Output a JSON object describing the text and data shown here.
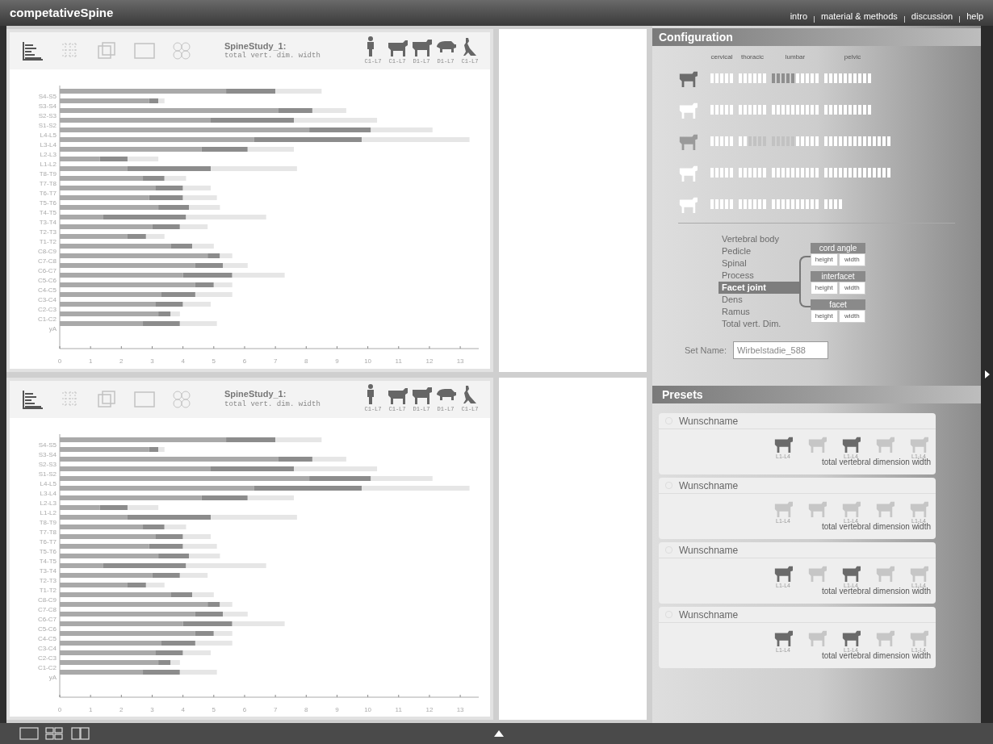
{
  "app_title": "competativeSpine",
  "nav": [
    "intro",
    "material & methods",
    "discussion",
    "help"
  ],
  "panels": [
    {
      "view_tools": [
        {
          "kind": "bars",
          "selected": true
        },
        {
          "kind": "grid",
          "selected": false
        },
        {
          "kind": "cube",
          "selected": false
        },
        {
          "kind": "frame",
          "selected": false
        },
        {
          "kind": "cluster",
          "selected": false
        }
      ],
      "title": "SpineStudy_1:",
      "subtitle": "total vert. dim. width",
      "species": [
        {
          "kind": "human",
          "label": "C1-L7"
        },
        {
          "kind": "sheep",
          "label": "C1-L7"
        },
        {
          "kind": "cow",
          "label": "D1-L7"
        },
        {
          "kind": "pig",
          "label": "D1-L7"
        },
        {
          "kind": "kangaroo",
          "label": "C1-L7"
        }
      ],
      "chart_data": {
        "type": "bar",
        "orientation": "horizontal",
        "stacked": true,
        "categories": [
          "S4-S5",
          "S3-S4",
          "S2-S3",
          "S1-S2",
          "L4-L5",
          "L3-L4",
          "L2-L3",
          "L1-L2",
          "T8-T9",
          "T7-T8",
          "T6-T7",
          "T5-T6",
          "T4-T5",
          "T3-T4",
          "T2-T3",
          "T1-T2",
          "C8-C9",
          "C7-C8",
          "C6-C7",
          "C5-C6",
          "C4-C5",
          "C3-C4",
          "C2-C3",
          "C1-C2",
          "yA"
        ],
        "series": [
          {
            "color": "#a9a9a9",
            "values": [
              5.4,
              2.9,
              7.1,
              4.9,
              8.1,
              6.3,
              4.6,
              1.3,
              2.2,
              2.7,
              3.1,
              2.9,
              3.2,
              1.4,
              3.0,
              2.2,
              3.6,
              4.8,
              4.4,
              4.0,
              4.4,
              3.3,
              3.1,
              3.2,
              2.7
            ]
          },
          {
            "color": "#8c8c8c",
            "values": [
              1.6,
              0.3,
              1.1,
              2.7,
              2.0,
              3.5,
              1.5,
              0.9,
              2.7,
              0.7,
              0.9,
              1.1,
              1.0,
              2.7,
              0.9,
              0.6,
              0.7,
              0.4,
              0.9,
              1.6,
              0.6,
              1.1,
              0.9,
              0.4,
              1.2
            ]
          },
          {
            "color": "#e6e6e6",
            "values": [
              1.5,
              0.2,
              1.1,
              2.7,
              2.0,
              3.5,
              1.5,
              1.0,
              2.8,
              0.7,
              0.9,
              1.1,
              1.0,
              2.6,
              0.9,
              0.6,
              0.7,
              0.4,
              0.8,
              1.7,
              0.6,
              1.2,
              0.9,
              0.3,
              1.2
            ]
          }
        ],
        "xlim": [
          0,
          13.6
        ],
        "xticks": [
          0,
          1,
          2,
          3,
          4,
          5,
          6,
          7,
          8,
          9,
          10,
          11,
          12,
          13
        ]
      }
    },
    {
      "view_tools": [
        {
          "kind": "bars",
          "selected": true
        },
        {
          "kind": "grid",
          "selected": false
        },
        {
          "kind": "cube",
          "selected": false
        },
        {
          "kind": "frame",
          "selected": false
        },
        {
          "kind": "cluster",
          "selected": false
        }
      ],
      "title": "SpineStudy_1:",
      "subtitle": "total vert. dim. width",
      "species": [
        {
          "kind": "human",
          "label": "C1-L7"
        },
        {
          "kind": "sheep",
          "label": "C1-L7"
        },
        {
          "kind": "cow",
          "label": "D1-L7"
        },
        {
          "kind": "pig",
          "label": "D1-L7"
        },
        {
          "kind": "kangaroo",
          "label": "C1-L7"
        }
      ],
      "chart_data": {
        "type": "bar",
        "orientation": "horizontal",
        "stacked": true,
        "categories": [
          "S4-S5",
          "S3-S4",
          "S2-S3",
          "S1-S2",
          "L4-L5",
          "L3-L4",
          "L2-L3",
          "L1-L2",
          "T8-T9",
          "T7-T8",
          "T6-T7",
          "T5-T6",
          "T4-T5",
          "T3-T4",
          "T2-T3",
          "T1-T2",
          "C8-C9",
          "C7-C8",
          "C6-C7",
          "C5-C6",
          "C4-C5",
          "C3-C4",
          "C2-C3",
          "C1-C2",
          "yA"
        ],
        "series": [
          {
            "color": "#a9a9a9",
            "values": [
              5.4,
              2.9,
              7.1,
              4.9,
              8.1,
              6.3,
              4.6,
              1.3,
              2.2,
              2.7,
              3.1,
              2.9,
              3.2,
              1.4,
              3.0,
              2.2,
              3.6,
              4.8,
              4.4,
              4.0,
              4.4,
              3.3,
              3.1,
              3.2,
              2.7
            ]
          },
          {
            "color": "#8c8c8c",
            "values": [
              1.6,
              0.3,
              1.1,
              2.7,
              2.0,
              3.5,
              1.5,
              0.9,
              2.7,
              0.7,
              0.9,
              1.1,
              1.0,
              2.7,
              0.9,
              0.6,
              0.7,
              0.4,
              0.9,
              1.6,
              0.6,
              1.1,
              0.9,
              0.4,
              1.2
            ]
          },
          {
            "color": "#e6e6e6",
            "values": [
              1.5,
              0.2,
              1.1,
              2.7,
              2.0,
              3.5,
              1.5,
              1.0,
              2.8,
              0.7,
              0.9,
              1.1,
              1.0,
              2.6,
              0.9,
              0.6,
              0.7,
              0.4,
              0.8,
              1.7,
              0.6,
              1.2,
              0.9,
              0.3,
              1.2
            ]
          }
        ],
        "xlim": [
          0,
          13.6
        ],
        "xticks": [
          0,
          1,
          2,
          3,
          4,
          5,
          6,
          7,
          8,
          9,
          10,
          11,
          12,
          13
        ]
      }
    }
  ],
  "configuration": {
    "title": "Configuration",
    "regions": [
      "cervical",
      "thoracic",
      "lumbar",
      "pelvic"
    ],
    "rows": [
      {
        "color": "#6b6b6b",
        "groups": [
          [
            {
              "kind": "plain"
            },
            {
              "kind": "plain"
            },
            {
              "kind": "plain"
            },
            {
              "kind": "plain"
            },
            {
              "kind": "plain"
            }
          ],
          [
            {
              "kind": "plain"
            },
            {
              "kind": "plain"
            },
            {
              "kind": "plain"
            },
            {
              "kind": "plain"
            },
            {
              "kind": "plain"
            },
            {
              "kind": "plain"
            }
          ],
          [
            {
              "kind": "dark"
            },
            {
              "kind": "dark"
            },
            {
              "kind": "dark"
            },
            {
              "kind": "dark"
            },
            {
              "kind": "dark"
            },
            {
              "kind": "plain"
            },
            {
              "kind": "plain"
            },
            {
              "kind": "plain"
            },
            {
              "kind": "plain"
            },
            {
              "kind": "plain"
            }
          ],
          [
            {
              "kind": "plain"
            },
            {
              "kind": "plain"
            },
            {
              "kind": "plain"
            },
            {
              "kind": "plain"
            },
            {
              "kind": "plain"
            },
            {
              "kind": "plain"
            },
            {
              "kind": "plain"
            },
            {
              "kind": "plain"
            },
            {
              "kind": "plain"
            },
            {
              "kind": "plain"
            }
          ]
        ]
      },
      {
        "color": "#ffffff",
        "groups": [
          [
            {
              "kind": "plain"
            },
            {
              "kind": "plain"
            },
            {
              "kind": "plain"
            },
            {
              "kind": "plain"
            },
            {
              "kind": "plain"
            }
          ],
          [
            {
              "kind": "plain"
            },
            {
              "kind": "plain"
            },
            {
              "kind": "plain"
            },
            {
              "kind": "plain"
            },
            {
              "kind": "plain"
            },
            {
              "kind": "plain"
            }
          ],
          [
            {
              "kind": "plain"
            },
            {
              "kind": "plain"
            },
            {
              "kind": "plain"
            },
            {
              "kind": "plain"
            },
            {
              "kind": "plain"
            },
            {
              "kind": "plain"
            },
            {
              "kind": "plain"
            },
            {
              "kind": "plain"
            },
            {
              "kind": "plain"
            },
            {
              "kind": "plain"
            }
          ],
          [
            {
              "kind": "plain"
            },
            {
              "kind": "plain"
            },
            {
              "kind": "plain"
            },
            {
              "kind": "plain"
            },
            {
              "kind": "plain"
            },
            {
              "kind": "plain"
            },
            {
              "kind": "plain"
            },
            {
              "kind": "plain"
            },
            {
              "kind": "plain"
            },
            {
              "kind": "plain"
            }
          ]
        ]
      },
      {
        "color": "#9a9a9a",
        "groups": [
          [
            {
              "kind": "plain"
            },
            {
              "kind": "plain"
            },
            {
              "kind": "plain"
            },
            {
              "kind": "plain"
            },
            {
              "kind": "plain"
            }
          ],
          [
            {
              "kind": "plain"
            },
            {
              "kind": "plain"
            },
            {
              "kind": "faint"
            },
            {
              "kind": "faint"
            },
            {
              "kind": "faint"
            },
            {
              "kind": "faint"
            }
          ],
          [
            {
              "kind": "faint"
            },
            {
              "kind": "faint"
            },
            {
              "kind": "faint"
            },
            {
              "kind": "faint"
            },
            {
              "kind": "faint"
            },
            {
              "kind": "plain"
            },
            {
              "kind": "plain"
            },
            {
              "kind": "plain"
            },
            {
              "kind": "plain"
            },
            {
              "kind": "plain"
            }
          ],
          [
            {
              "kind": "plain"
            },
            {
              "kind": "plain"
            },
            {
              "kind": "plain"
            },
            {
              "kind": "plain"
            },
            {
              "kind": "plain"
            },
            {
              "kind": "plain"
            },
            {
              "kind": "plain"
            },
            {
              "kind": "plain"
            },
            {
              "kind": "plain"
            },
            {
              "kind": "plain"
            },
            {
              "kind": "plain"
            },
            {
              "kind": "plain"
            },
            {
              "kind": "plain"
            },
            {
              "kind": "plain"
            }
          ]
        ]
      },
      {
        "color": "#ffffff",
        "groups": [
          [
            {
              "kind": "plain"
            },
            {
              "kind": "plain"
            },
            {
              "kind": "plain"
            },
            {
              "kind": "plain"
            },
            {
              "kind": "plain"
            }
          ],
          [
            {
              "kind": "plain"
            },
            {
              "kind": "plain"
            },
            {
              "kind": "plain"
            },
            {
              "kind": "plain"
            },
            {
              "kind": "plain"
            },
            {
              "kind": "plain"
            }
          ],
          [
            {
              "kind": "plain"
            },
            {
              "kind": "plain"
            },
            {
              "kind": "plain"
            },
            {
              "kind": "plain"
            },
            {
              "kind": "plain"
            },
            {
              "kind": "plain"
            },
            {
              "kind": "plain"
            },
            {
              "kind": "plain"
            },
            {
              "kind": "plain"
            },
            {
              "kind": "plain"
            }
          ],
          [
            {
              "kind": "plain"
            },
            {
              "kind": "plain"
            },
            {
              "kind": "plain"
            },
            {
              "kind": "plain"
            },
            {
              "kind": "plain"
            },
            {
              "kind": "plain"
            },
            {
              "kind": "plain"
            },
            {
              "kind": "plain"
            },
            {
              "kind": "plain"
            },
            {
              "kind": "plain"
            },
            {
              "kind": "plain"
            },
            {
              "kind": "plain"
            },
            {
              "kind": "plain"
            },
            {
              "kind": "plain"
            }
          ]
        ]
      },
      {
        "color": "#ffffff",
        "groups": [
          [
            {
              "kind": "plain"
            },
            {
              "kind": "plain"
            },
            {
              "kind": "plain"
            },
            {
              "kind": "plain"
            },
            {
              "kind": "plain"
            }
          ],
          [
            {
              "kind": "plain"
            },
            {
              "kind": "plain"
            },
            {
              "kind": "plain"
            },
            {
              "kind": "plain"
            },
            {
              "kind": "plain"
            },
            {
              "kind": "plain"
            }
          ],
          [
            {
              "kind": "plain"
            },
            {
              "kind": "plain"
            },
            {
              "kind": "plain"
            },
            {
              "kind": "plain"
            },
            {
              "kind": "plain"
            },
            {
              "kind": "plain"
            },
            {
              "kind": "plain"
            },
            {
              "kind": "plain"
            },
            {
              "kind": "plain"
            },
            {
              "kind": "plain"
            }
          ],
          [
            {
              "kind": "plain"
            },
            {
              "kind": "plain"
            },
            {
              "kind": "plain"
            },
            {
              "kind": "plain"
            }
          ]
        ]
      }
    ],
    "parts": [
      {
        "label": "Vertebral body",
        "selected": false
      },
      {
        "label": "Pedicle",
        "selected": false
      },
      {
        "label": "Spinal",
        "selected": false
      },
      {
        "label": "Process",
        "selected": false
      },
      {
        "label": "Facet joint",
        "selected": true
      },
      {
        "label": "Dens",
        "selected": false
      },
      {
        "label": "Ramus",
        "selected": false
      },
      {
        "label": "Total vert. Dim.",
        "selected": false
      }
    ],
    "measures": [
      {
        "label": "cord angle",
        "options": [
          "height",
          "width"
        ]
      },
      {
        "label": "interfacet",
        "options": [
          "height",
          "width"
        ]
      },
      {
        "label": "facet",
        "options": [
          "height",
          "width"
        ]
      }
    ]
  },
  "set_name": {
    "label": "Set Name:",
    "value": "Wirbelstadie_588"
  },
  "presets": {
    "title": "Presets",
    "items": [
      {
        "name": "Wunschname",
        "checked": false,
        "caption": "total vertebral dimension width",
        "animals": [
          {
            "selected": true,
            "label": "L1-L4"
          },
          {
            "selected": false
          },
          {
            "selected": true,
            "label": "L1-L4"
          },
          {
            "selected": false
          },
          {
            "selected": false,
            "label": "L1-L4"
          }
        ]
      },
      {
        "name": "Wunschname",
        "checked": false,
        "caption": "total vertebral dimension width",
        "animals": [
          {
            "selected": false,
            "label": "L1-L4"
          },
          {
            "selected": false
          },
          {
            "selected": false,
            "label": "L1-L4"
          },
          {
            "selected": false
          },
          {
            "selected": false,
            "label": "L1-L4"
          }
        ]
      },
      {
        "name": "Wunschname",
        "checked": false,
        "caption": "total vertebral dimension width",
        "animals": [
          {
            "selected": true,
            "label": "L1-L4"
          },
          {
            "selected": false
          },
          {
            "selected": true,
            "label": "L1-L4"
          },
          {
            "selected": false
          },
          {
            "selected": false,
            "label": "L1-L4"
          }
        ]
      },
      {
        "name": "Wunschname",
        "checked": false,
        "caption": "total vertebral dimension width",
        "animals": [
          {
            "selected": true,
            "label": "L1-L4"
          },
          {
            "selected": false
          },
          {
            "selected": true,
            "label": "L1-L4"
          },
          {
            "selected": false
          },
          {
            "selected": false,
            "label": "L1-L4"
          }
        ]
      }
    ]
  },
  "layouts": [
    {
      "kind": "single",
      "selected": false
    },
    {
      "kind": "quad",
      "selected": false
    },
    {
      "kind": "split",
      "selected": false
    }
  ]
}
